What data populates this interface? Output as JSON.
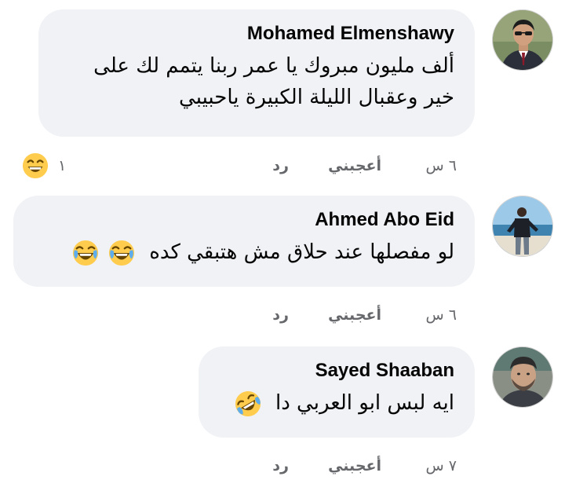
{
  "comments": [
    {
      "author": "Mohamed Elmenshawy",
      "lines": [
        "ألف مليون مبروك يا عمر ربنا يتمم لك على",
        "خير وعقبال الليلة الكبيرة ياحبيبي"
      ],
      "time": "٦ س",
      "like_label": "أعجبني",
      "reply_label": "رد",
      "reaction_count": "١",
      "reaction_icon": "grinning-face-icon"
    },
    {
      "author": "Ahmed Abo Eid",
      "text": "لو مفصلها عند حلاق مش هتبقي كده",
      "emojis": [
        "face-with-tears-of-joy-icon",
        "face-with-tears-of-joy-icon"
      ],
      "time": "٦ س",
      "like_label": "أعجبني",
      "reply_label": "رد"
    },
    {
      "author": "Sayed Shaaban",
      "text": "ايه لبس ابو العربي دا",
      "emojis": [
        "rolling-on-floor-laughing-icon"
      ],
      "time": "٧ س",
      "like_label": "أعجبني",
      "reply_label": "رد"
    }
  ],
  "colors": {
    "bubble": "#f0f2f5",
    "meta_text": "#65676b",
    "primary_text": "#050505",
    "emoji_yellow": "#ffcc4d"
  }
}
